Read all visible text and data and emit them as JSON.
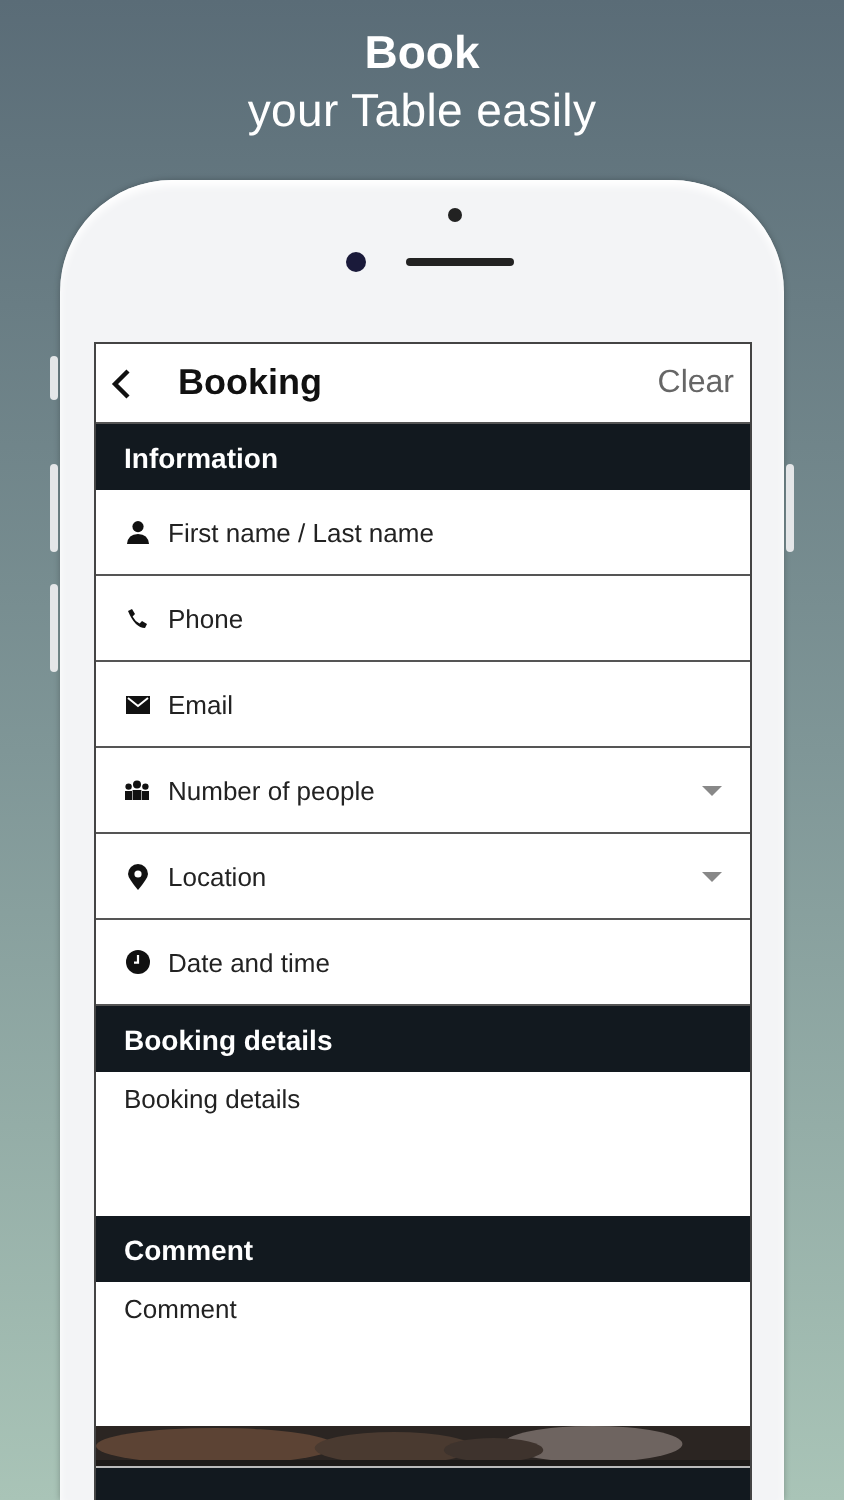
{
  "promo": {
    "title": "Book",
    "subtitle": "your Table easily"
  },
  "app_bar": {
    "title": "Booking",
    "action": "Clear"
  },
  "sections": [
    {
      "title": "Information",
      "fields": [
        {
          "kind": "text",
          "placeholder": "First name / Last name"
        },
        {
          "kind": "text",
          "placeholder": "Phone"
        },
        {
          "kind": "text",
          "placeholder": "Email"
        },
        {
          "kind": "select",
          "placeholder": "Number of people"
        },
        {
          "kind": "select",
          "placeholder": "Location"
        },
        {
          "kind": "text",
          "placeholder": "Date and time"
        }
      ]
    },
    {
      "title": "Booking details",
      "fields": [
        {
          "kind": "textarea",
          "placeholder": "Booking details"
        }
      ]
    },
    {
      "title": "Comment",
      "fields": [
        {
          "kind": "textarea",
          "placeholder": "Comment"
        }
      ]
    }
  ]
}
